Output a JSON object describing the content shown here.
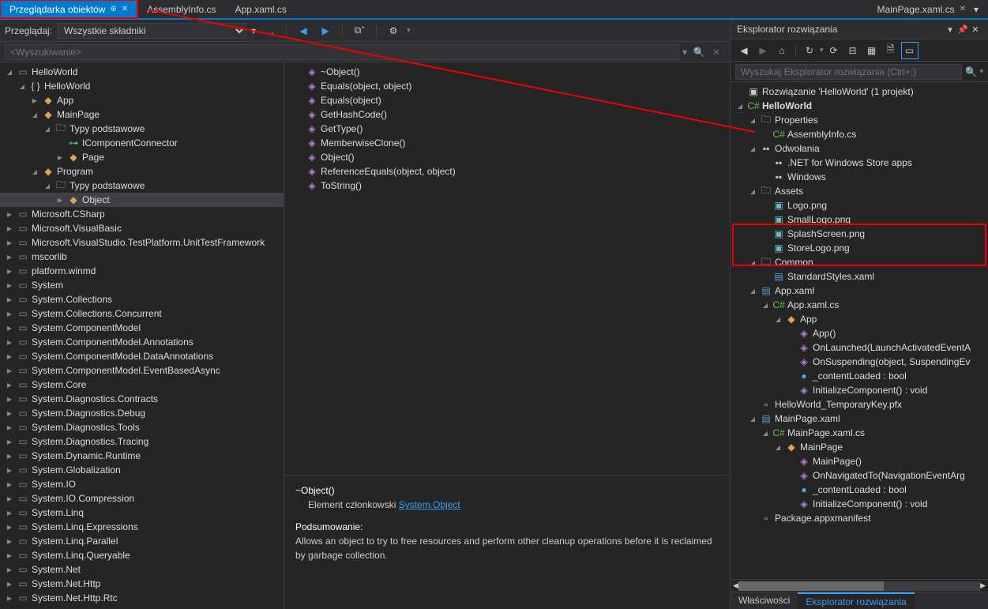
{
  "tabs": [
    {
      "label": "Przeglądarka obiektów",
      "active": true,
      "pinned": true,
      "close": true
    },
    {
      "label": "AssemblyInfo.cs"
    },
    {
      "label": "App.xaml.cs"
    },
    {
      "label": "MainPage.xaml.cs",
      "right": true,
      "close": true
    }
  ],
  "browse": {
    "label": "Przeglądaj:",
    "scope": "Wszystkie składniki"
  },
  "search_placeholder": "<Wyszukiwanie>",
  "left_tree": [
    {
      "d": 0,
      "a": "open",
      "i": "asm",
      "t": "HelloWorld"
    },
    {
      "d": 1,
      "a": "open",
      "i": "ns",
      "t": "HelloWorld"
    },
    {
      "d": 2,
      "a": "closed",
      "i": "cls",
      "t": "App"
    },
    {
      "d": 2,
      "a": "open",
      "i": "cls",
      "t": "MainPage"
    },
    {
      "d": 3,
      "a": "open",
      "i": "fold",
      "t": "Typy podstawowe"
    },
    {
      "d": 4,
      "a": "",
      "i": "iface",
      "t": "IComponentConnector"
    },
    {
      "d": 4,
      "a": "closed",
      "i": "cls",
      "t": "Page"
    },
    {
      "d": 2,
      "a": "open",
      "i": "cls",
      "t": "Program"
    },
    {
      "d": 3,
      "a": "open",
      "i": "fold",
      "t": "Typy podstawowe"
    },
    {
      "d": 4,
      "a": "closed",
      "i": "cls",
      "t": "Object",
      "sel": true
    },
    {
      "d": 0,
      "a": "closed",
      "i": "asm",
      "t": "Microsoft.CSharp"
    },
    {
      "d": 0,
      "a": "closed",
      "i": "asm",
      "t": "Microsoft.VisualBasic"
    },
    {
      "d": 0,
      "a": "closed",
      "i": "asm",
      "t": "Microsoft.VisualStudio.TestPlatform.UnitTestFramework"
    },
    {
      "d": 0,
      "a": "closed",
      "i": "asm",
      "t": "mscorlib"
    },
    {
      "d": 0,
      "a": "closed",
      "i": "asm",
      "t": "platform.winmd"
    },
    {
      "d": 0,
      "a": "closed",
      "i": "asm",
      "t": "System"
    },
    {
      "d": 0,
      "a": "closed",
      "i": "asm",
      "t": "System.Collections"
    },
    {
      "d": 0,
      "a": "closed",
      "i": "asm",
      "t": "System.Collections.Concurrent"
    },
    {
      "d": 0,
      "a": "closed",
      "i": "asm",
      "t": "System.ComponentModel"
    },
    {
      "d": 0,
      "a": "closed",
      "i": "asm",
      "t": "System.ComponentModel.Annotations"
    },
    {
      "d": 0,
      "a": "closed",
      "i": "asm",
      "t": "System.ComponentModel.DataAnnotations"
    },
    {
      "d": 0,
      "a": "closed",
      "i": "asm",
      "t": "System.ComponentModel.EventBasedAsync"
    },
    {
      "d": 0,
      "a": "closed",
      "i": "asm",
      "t": "System.Core"
    },
    {
      "d": 0,
      "a": "closed",
      "i": "asm",
      "t": "System.Diagnostics.Contracts"
    },
    {
      "d": 0,
      "a": "closed",
      "i": "asm",
      "t": "System.Diagnostics.Debug"
    },
    {
      "d": 0,
      "a": "closed",
      "i": "asm",
      "t": "System.Diagnostics.Tools"
    },
    {
      "d": 0,
      "a": "closed",
      "i": "asm",
      "t": "System.Diagnostics.Tracing"
    },
    {
      "d": 0,
      "a": "closed",
      "i": "asm",
      "t": "System.Dynamic.Runtime"
    },
    {
      "d": 0,
      "a": "closed",
      "i": "asm",
      "t": "System.Globalization"
    },
    {
      "d": 0,
      "a": "closed",
      "i": "asm",
      "t": "System.IO"
    },
    {
      "d": 0,
      "a": "closed",
      "i": "asm",
      "t": "System.IO.Compression"
    },
    {
      "d": 0,
      "a": "closed",
      "i": "asm",
      "t": "System.Linq"
    },
    {
      "d": 0,
      "a": "closed",
      "i": "asm",
      "t": "System.Linq.Expressions"
    },
    {
      "d": 0,
      "a": "closed",
      "i": "asm",
      "t": "System.Linq.Parallel"
    },
    {
      "d": 0,
      "a": "closed",
      "i": "asm",
      "t": "System.Linq.Queryable"
    },
    {
      "d": 0,
      "a": "closed",
      "i": "asm",
      "t": "System.Net"
    },
    {
      "d": 0,
      "a": "closed",
      "i": "asm",
      "t": "System.Net.Http"
    },
    {
      "d": 0,
      "a": "closed",
      "i": "asm",
      "t": "System.Net.Http.Rtc"
    }
  ],
  "members": [
    {
      "i": "method",
      "t": "~Object()"
    },
    {
      "i": "method",
      "t": "Equals(object, object)"
    },
    {
      "i": "method",
      "t": "Equals(object)"
    },
    {
      "i": "method",
      "t": "GetHashCode()"
    },
    {
      "i": "method",
      "t": "GetType()"
    },
    {
      "i": "method",
      "t": "MemberwiseClone()"
    },
    {
      "i": "method",
      "t": "Object()"
    },
    {
      "i": "method",
      "t": "ReferenceEquals(object, object)"
    },
    {
      "i": "method",
      "t": "ToString()"
    }
  ],
  "detail": {
    "name": "~Object()",
    "member_of_label": "Element członkowski",
    "member_of_link": "System.Object",
    "summary_label": "Podsumowanie:",
    "summary_text": "Allows an object to try to free resources and perform other cleanup operations before it is reclaimed by garbage collection."
  },
  "sol": {
    "title": "Eksplorator rozwiązania",
    "search_placeholder": "Wyszukaj Eksplorator rozwiązania (Ctrl+;)",
    "tree": [
      {
        "d": 0,
        "a": "",
        "i": "sol",
        "t": "Rozwiązanie 'HelloWorld' (1 projekt)"
      },
      {
        "d": 0,
        "a": "open",
        "i": "cs",
        "t": "HelloWorld",
        "bold": true
      },
      {
        "d": 1,
        "a": "open",
        "i": "fold",
        "t": "Properties"
      },
      {
        "d": 2,
        "a": "",
        "i": "cs",
        "t": "AssemblyInfo.cs"
      },
      {
        "d": 1,
        "a": "open",
        "i": "ref",
        "t": "Odwołania",
        "hl": true
      },
      {
        "d": 2,
        "a": "",
        "i": "ref",
        "t": ".NET for Windows Store apps",
        "hl": true
      },
      {
        "d": 2,
        "a": "",
        "i": "ref",
        "t": "Windows",
        "hl": true
      },
      {
        "d": 1,
        "a": "open",
        "i": "fold",
        "t": "Assets"
      },
      {
        "d": 2,
        "a": "",
        "i": "img",
        "t": "Logo.png"
      },
      {
        "d": 2,
        "a": "",
        "i": "img",
        "t": "SmallLogo.png"
      },
      {
        "d": 2,
        "a": "",
        "i": "img",
        "t": "SplashScreen.png"
      },
      {
        "d": 2,
        "a": "",
        "i": "img",
        "t": "StoreLogo.png"
      },
      {
        "d": 1,
        "a": "open",
        "i": "fold",
        "t": "Common"
      },
      {
        "d": 2,
        "a": "",
        "i": "xaml",
        "t": "StandardStyles.xaml"
      },
      {
        "d": 1,
        "a": "open",
        "i": "xaml",
        "t": "App.xaml"
      },
      {
        "d": 2,
        "a": "open",
        "i": "cs",
        "t": "App.xaml.cs"
      },
      {
        "d": 3,
        "a": "open",
        "i": "cls",
        "t": "App"
      },
      {
        "d": 4,
        "a": "",
        "i": "method",
        "t": "App()"
      },
      {
        "d": 4,
        "a": "",
        "i": "method",
        "t": "OnLaunched(LaunchActivatedEventA"
      },
      {
        "d": 4,
        "a": "",
        "i": "method",
        "t": "OnSuspending(object, SuspendingEv"
      },
      {
        "d": 4,
        "a": "",
        "i": "field",
        "t": "_contentLoaded : bool"
      },
      {
        "d": 4,
        "a": "",
        "i": "method",
        "t": "InitializeComponent() : void"
      },
      {
        "d": 1,
        "a": "",
        "i": "file",
        "t": "HelloWorld_TemporaryKey.pfx"
      },
      {
        "d": 1,
        "a": "open",
        "i": "xaml",
        "t": "MainPage.xaml"
      },
      {
        "d": 2,
        "a": "open",
        "i": "cs",
        "t": "MainPage.xaml.cs"
      },
      {
        "d": 3,
        "a": "open",
        "i": "cls",
        "t": "MainPage"
      },
      {
        "d": 4,
        "a": "",
        "i": "method",
        "t": "MainPage()"
      },
      {
        "d": 4,
        "a": "",
        "i": "method",
        "t": "OnNavigatedTo(NavigationEventArg"
      },
      {
        "d": 4,
        "a": "",
        "i": "field",
        "t": "_contentLoaded : bool"
      },
      {
        "d": 4,
        "a": "",
        "i": "method",
        "t": "InitializeComponent() : void"
      },
      {
        "d": 1,
        "a": "",
        "i": "file",
        "t": "Package.appxmanifest"
      }
    ],
    "bottom_tabs": [
      {
        "label": "Właściwości"
      },
      {
        "label": "Eksplorator rozwiązania",
        "active": true
      }
    ]
  },
  "icons": {
    "asm": "▭",
    "ns": "{ }",
    "cls": "◆",
    "fold": "🗀",
    "iface": "⊶",
    "method": "◈",
    "ref": "▪▪",
    "cs": "C#",
    "xaml": "▤",
    "img": "▣",
    "field": "●",
    "sol": "▣",
    "file": "▫"
  }
}
